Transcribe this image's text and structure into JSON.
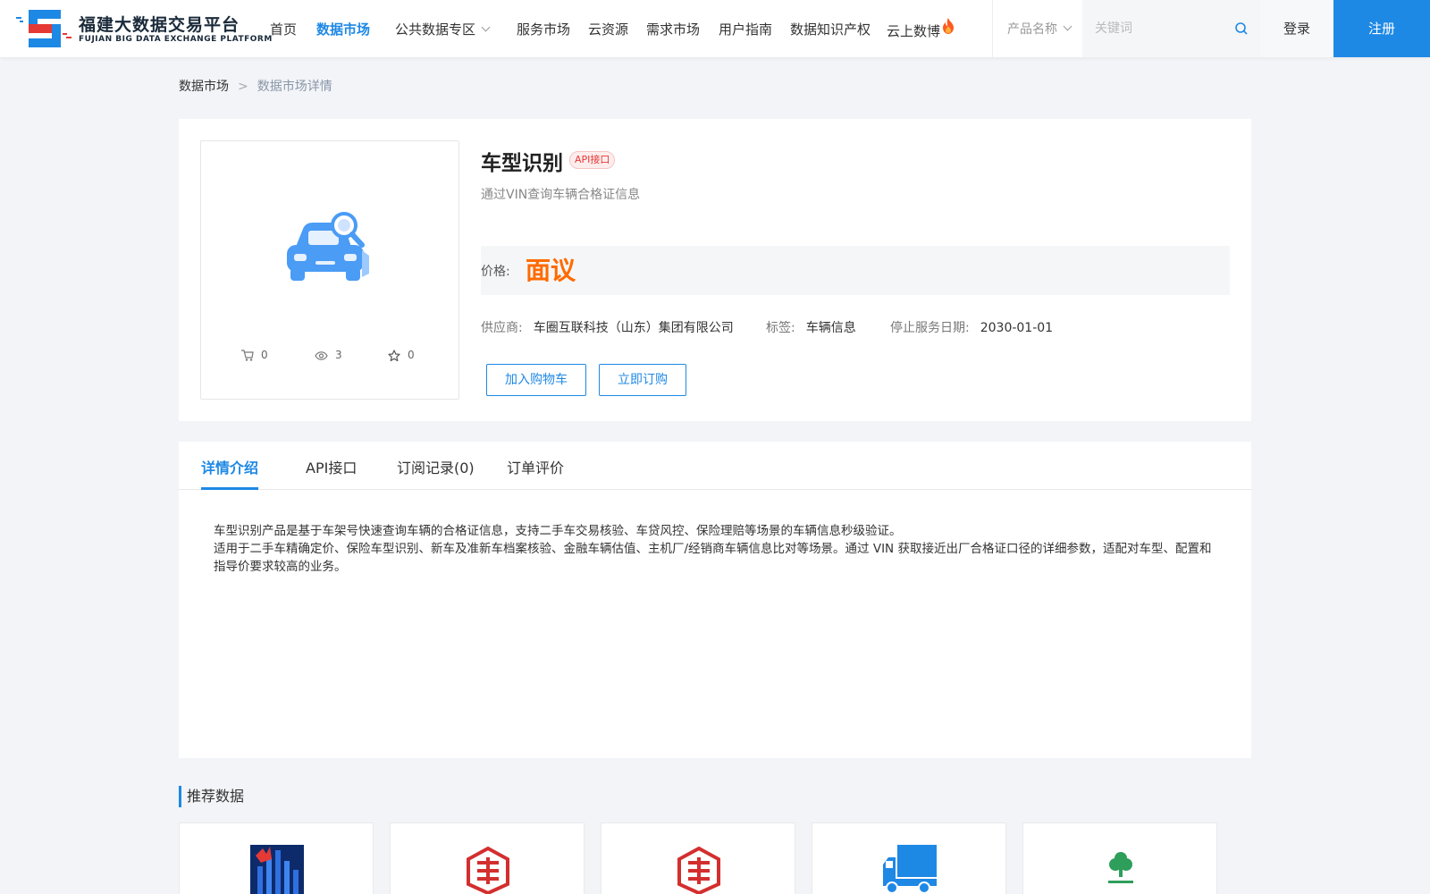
{
  "header": {
    "logo_cn": "福建大数据交易平台",
    "logo_en": "FUJIAN BIG DATA EXCHANGE  PLATFORM",
    "nav": [
      {
        "label": "首页"
      },
      {
        "label": "数据市场"
      },
      {
        "label": "公共数据专区"
      },
      {
        "label": "服务市场"
      },
      {
        "label": "云资源"
      },
      {
        "label": "需求市场"
      },
      {
        "label": "用户指南"
      },
      {
        "label": "数据知识产权"
      },
      {
        "label": "云上数博"
      }
    ],
    "active_nav": "数据市场",
    "search_select": "产品名称",
    "search_placeholder": "关键词",
    "login": "登录",
    "register": "注册"
  },
  "breadcrumb": {
    "parent": "数据市场",
    "separator": ">",
    "current": "数据市场详情"
  },
  "product": {
    "title": "车型识别",
    "badge": "API接口",
    "subtitle": "通过VIN查询车辆合格证信息",
    "price_label": "价格:",
    "price_value": "面议",
    "stats": {
      "cart": "0",
      "views": "3",
      "favorites": "0"
    },
    "supplier_label": "供应商:",
    "supplier": "车圈互联科技（山东）集团有限公司",
    "tag_label": "标签:",
    "tag": "车辆信息",
    "stop_label": "停止服务日期:",
    "stop_date": "2030-01-01",
    "add_cart": "加入购物车",
    "subscribe": "立即订购"
  },
  "tabs": [
    {
      "label": "详情介绍"
    },
    {
      "label": "API接口"
    },
    {
      "label": "订阅记录(0)"
    },
    {
      "label": "订单评价"
    }
  ],
  "active_tab": "详情介绍",
  "description": {
    "line1": "车型识别产品是基于车架号快速查询车辆的合格证信息，支持二手车交易核验、车贷风控、保险理赔等场景的车辆信息秒级验证。",
    "line2": "适用于二手车精确定价、保险车型识别、新车及准新车档案核验、金融车辆估值、主机厂/经销商车辆信息比对等场景。通过 VIN 获取接近出厂合格证口径的详细参数，适配对车型、配置和指导价要求较高的业务。"
  },
  "recommended": {
    "title": "推荐数据",
    "items": [
      {
        "icon": "city-chart-logo"
      },
      {
        "icon": "red-seal-logo"
      },
      {
        "icon": "red-seal-logo"
      },
      {
        "icon": "truck-icon"
      },
      {
        "icon": "green-tree-logo"
      }
    ]
  },
  "colors": {
    "accent": "#1e88e5",
    "price": "#ff6a00",
    "badge": "#e53935"
  }
}
